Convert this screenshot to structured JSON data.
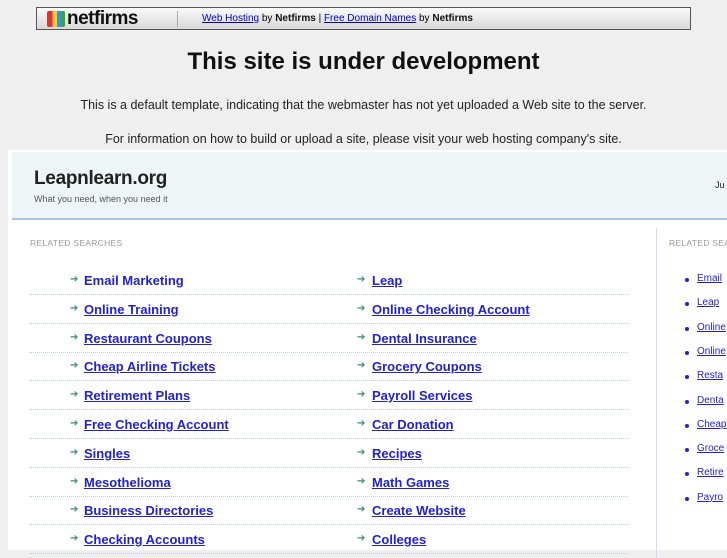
{
  "topbar": {
    "logo": "netfirms",
    "link1": "Web Hosting",
    "by": "by",
    "brand": "Netfirms",
    "pipe": "|",
    "link2": "Free Domain Names"
  },
  "title": "This site is under development",
  "info1": "This is a default template, indicating that the webmaster has not yet uploaded a Web site to the server.",
  "info2": "For information on how to build or upload a site, please visit your web hosting company's site.",
  "site": {
    "name": "Leapnlearn.org",
    "tagline": "What you need, when you need it",
    "right_text": "Ju"
  },
  "related_label": "RELATED SEARCHES",
  "related_label_right": "RELATED SEA",
  "rows": [
    [
      "Email Marketing",
      "Leap"
    ],
    [
      "Online Training",
      "Online Checking Account"
    ],
    [
      "Restaurant Coupons",
      "Dental Insurance"
    ],
    [
      "Cheap Airline Tickets",
      "Grocery Coupons"
    ],
    [
      "Retirement Plans",
      "Payroll Services"
    ],
    [
      "Free Checking Account",
      "Car Donation"
    ],
    [
      "Singles",
      "Recipes"
    ],
    [
      "Mesothelioma",
      "Math Games"
    ],
    [
      "Business Directories",
      "Create Website"
    ],
    [
      "Checking Accounts",
      "Colleges"
    ]
  ],
  "right_items": [
    "Email",
    "Leap",
    "Online",
    "Online",
    "Resta",
    "Denta",
    "Cheap",
    "Groce",
    "Retire",
    "Payro"
  ]
}
